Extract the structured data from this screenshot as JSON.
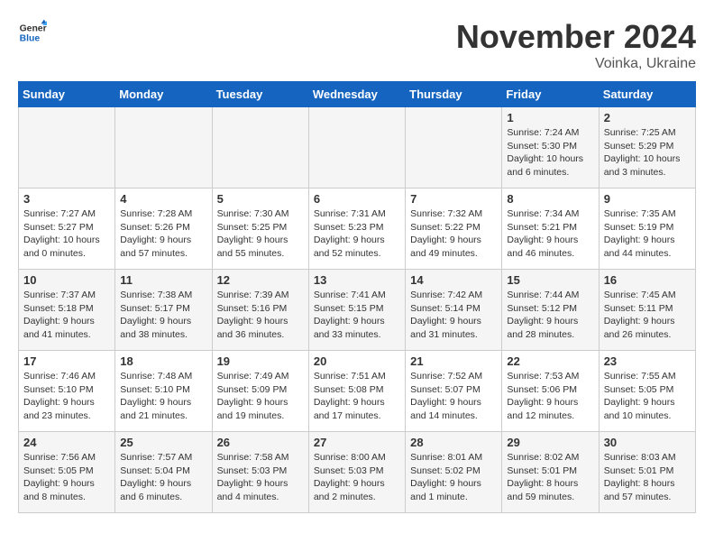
{
  "header": {
    "logo_line1": "General",
    "logo_line2": "Blue",
    "month_year": "November 2024",
    "location": "Voinka, Ukraine"
  },
  "weekdays": [
    "Sunday",
    "Monday",
    "Tuesday",
    "Wednesday",
    "Thursday",
    "Friday",
    "Saturday"
  ],
  "weeks": [
    [
      {
        "day": "",
        "info": ""
      },
      {
        "day": "",
        "info": ""
      },
      {
        "day": "",
        "info": ""
      },
      {
        "day": "",
        "info": ""
      },
      {
        "day": "",
        "info": ""
      },
      {
        "day": "1",
        "info": "Sunrise: 7:24 AM\nSunset: 5:30 PM\nDaylight: 10 hours\nand 6 minutes."
      },
      {
        "day": "2",
        "info": "Sunrise: 7:25 AM\nSunset: 5:29 PM\nDaylight: 10 hours\nand 3 minutes."
      }
    ],
    [
      {
        "day": "3",
        "info": "Sunrise: 7:27 AM\nSunset: 5:27 PM\nDaylight: 10 hours\nand 0 minutes."
      },
      {
        "day": "4",
        "info": "Sunrise: 7:28 AM\nSunset: 5:26 PM\nDaylight: 9 hours\nand 57 minutes."
      },
      {
        "day": "5",
        "info": "Sunrise: 7:30 AM\nSunset: 5:25 PM\nDaylight: 9 hours\nand 55 minutes."
      },
      {
        "day": "6",
        "info": "Sunrise: 7:31 AM\nSunset: 5:23 PM\nDaylight: 9 hours\nand 52 minutes."
      },
      {
        "day": "7",
        "info": "Sunrise: 7:32 AM\nSunset: 5:22 PM\nDaylight: 9 hours\nand 49 minutes."
      },
      {
        "day": "8",
        "info": "Sunrise: 7:34 AM\nSunset: 5:21 PM\nDaylight: 9 hours\nand 46 minutes."
      },
      {
        "day": "9",
        "info": "Sunrise: 7:35 AM\nSunset: 5:19 PM\nDaylight: 9 hours\nand 44 minutes."
      }
    ],
    [
      {
        "day": "10",
        "info": "Sunrise: 7:37 AM\nSunset: 5:18 PM\nDaylight: 9 hours\nand 41 minutes."
      },
      {
        "day": "11",
        "info": "Sunrise: 7:38 AM\nSunset: 5:17 PM\nDaylight: 9 hours\nand 38 minutes."
      },
      {
        "day": "12",
        "info": "Sunrise: 7:39 AM\nSunset: 5:16 PM\nDaylight: 9 hours\nand 36 minutes."
      },
      {
        "day": "13",
        "info": "Sunrise: 7:41 AM\nSunset: 5:15 PM\nDaylight: 9 hours\nand 33 minutes."
      },
      {
        "day": "14",
        "info": "Sunrise: 7:42 AM\nSunset: 5:14 PM\nDaylight: 9 hours\nand 31 minutes."
      },
      {
        "day": "15",
        "info": "Sunrise: 7:44 AM\nSunset: 5:12 PM\nDaylight: 9 hours\nand 28 minutes."
      },
      {
        "day": "16",
        "info": "Sunrise: 7:45 AM\nSunset: 5:11 PM\nDaylight: 9 hours\nand 26 minutes."
      }
    ],
    [
      {
        "day": "17",
        "info": "Sunrise: 7:46 AM\nSunset: 5:10 PM\nDaylight: 9 hours\nand 23 minutes."
      },
      {
        "day": "18",
        "info": "Sunrise: 7:48 AM\nSunset: 5:10 PM\nDaylight: 9 hours\nand 21 minutes."
      },
      {
        "day": "19",
        "info": "Sunrise: 7:49 AM\nSunset: 5:09 PM\nDaylight: 9 hours\nand 19 minutes."
      },
      {
        "day": "20",
        "info": "Sunrise: 7:51 AM\nSunset: 5:08 PM\nDaylight: 9 hours\nand 17 minutes."
      },
      {
        "day": "21",
        "info": "Sunrise: 7:52 AM\nSunset: 5:07 PM\nDaylight: 9 hours\nand 14 minutes."
      },
      {
        "day": "22",
        "info": "Sunrise: 7:53 AM\nSunset: 5:06 PM\nDaylight: 9 hours\nand 12 minutes."
      },
      {
        "day": "23",
        "info": "Sunrise: 7:55 AM\nSunset: 5:05 PM\nDaylight: 9 hours\nand 10 minutes."
      }
    ],
    [
      {
        "day": "24",
        "info": "Sunrise: 7:56 AM\nSunset: 5:05 PM\nDaylight: 9 hours\nand 8 minutes."
      },
      {
        "day": "25",
        "info": "Sunrise: 7:57 AM\nSunset: 5:04 PM\nDaylight: 9 hours\nand 6 minutes."
      },
      {
        "day": "26",
        "info": "Sunrise: 7:58 AM\nSunset: 5:03 PM\nDaylight: 9 hours\nand 4 minutes."
      },
      {
        "day": "27",
        "info": "Sunrise: 8:00 AM\nSunset: 5:03 PM\nDaylight: 9 hours\nand 2 minutes."
      },
      {
        "day": "28",
        "info": "Sunrise: 8:01 AM\nSunset: 5:02 PM\nDaylight: 9 hours\nand 1 minute."
      },
      {
        "day": "29",
        "info": "Sunrise: 8:02 AM\nSunset: 5:01 PM\nDaylight: 8 hours\nand 59 minutes."
      },
      {
        "day": "30",
        "info": "Sunrise: 8:03 AM\nSunset: 5:01 PM\nDaylight: 8 hours\nand 57 minutes."
      }
    ]
  ]
}
